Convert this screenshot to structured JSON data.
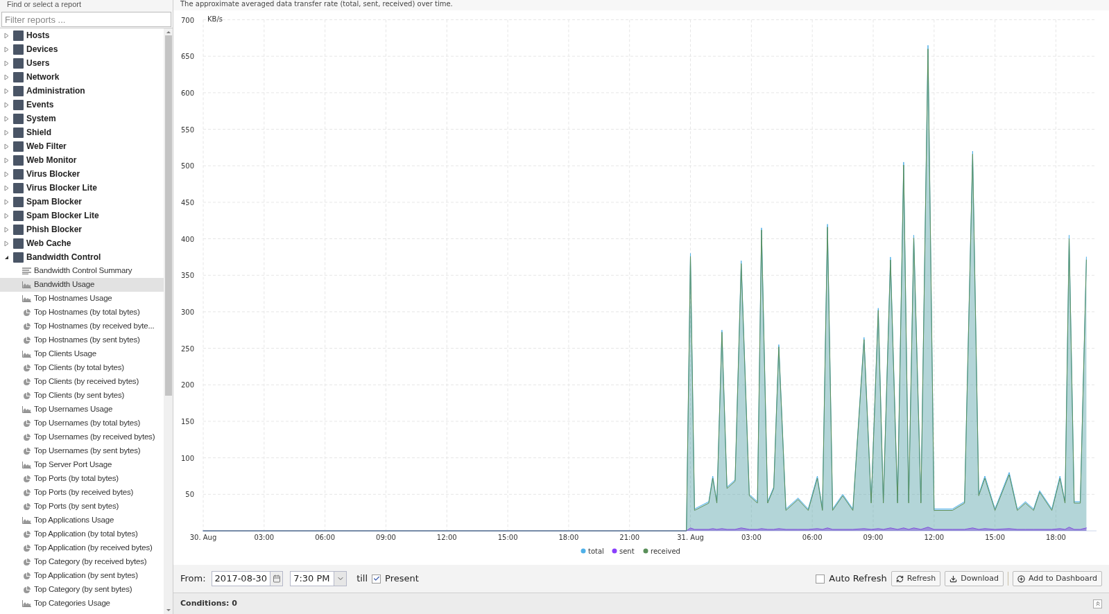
{
  "sidebar": {
    "title": "Find or select a report",
    "filter": {
      "placeholder": "Filter reports ..."
    },
    "items": [
      {
        "label": "Hosts",
        "expanded": false
      },
      {
        "label": "Devices",
        "expanded": false
      },
      {
        "label": "Users",
        "expanded": false
      },
      {
        "label": "Network",
        "expanded": false
      },
      {
        "label": "Administration",
        "expanded": false
      },
      {
        "label": "Events",
        "expanded": false
      },
      {
        "label": "System",
        "expanded": false
      },
      {
        "label": "Shield",
        "expanded": false
      },
      {
        "label": "Web Filter",
        "expanded": false
      },
      {
        "label": "Web Monitor",
        "expanded": false
      },
      {
        "label": "Virus Blocker",
        "expanded": false
      },
      {
        "label": "Virus Blocker Lite",
        "expanded": false
      },
      {
        "label": "Spam Blocker",
        "expanded": false
      },
      {
        "label": "Spam Blocker Lite",
        "expanded": false
      },
      {
        "label": "Phish Blocker",
        "expanded": false
      },
      {
        "label": "Web Cache",
        "expanded": false
      },
      {
        "label": "Bandwidth Control",
        "expanded": true,
        "children": [
          {
            "label": "Bandwidth Control Summary",
            "kind": "text",
            "selected": false
          },
          {
            "label": "Bandwidth Usage",
            "kind": "timeseries",
            "selected": true
          },
          {
            "label": "Top Hostnames Usage",
            "kind": "timeseries",
            "selected": false
          },
          {
            "label": "Top Hostnames (by total bytes)",
            "kind": "pie",
            "selected": false
          },
          {
            "label": "Top Hostnames (by received byte...",
            "kind": "pie",
            "selected": false
          },
          {
            "label": "Top Hostnames (by sent bytes)",
            "kind": "pie",
            "selected": false
          },
          {
            "label": "Top Clients Usage",
            "kind": "timeseries",
            "selected": false
          },
          {
            "label": "Top Clients (by total bytes)",
            "kind": "pie",
            "selected": false
          },
          {
            "label": "Top Clients (by received bytes)",
            "kind": "pie",
            "selected": false
          },
          {
            "label": "Top Clients (by sent bytes)",
            "kind": "pie",
            "selected": false
          },
          {
            "label": "Top Usernames Usage",
            "kind": "timeseries",
            "selected": false
          },
          {
            "label": "Top Usernames (by total bytes)",
            "kind": "pie",
            "selected": false
          },
          {
            "label": "Top Usernames (by received bytes)",
            "kind": "pie",
            "selected": false
          },
          {
            "label": "Top Usernames (by sent bytes)",
            "kind": "pie",
            "selected": false
          },
          {
            "label": "Top Server Port Usage",
            "kind": "timeseries",
            "selected": false
          },
          {
            "label": "Top Ports (by total bytes)",
            "kind": "pie",
            "selected": false
          },
          {
            "label": "Top Ports (by received bytes)",
            "kind": "pie",
            "selected": false
          },
          {
            "label": "Top Ports (by sent bytes)",
            "kind": "pie",
            "selected": false
          },
          {
            "label": "Top Applications Usage",
            "kind": "timeseries",
            "selected": false
          },
          {
            "label": "Top Application (by total bytes)",
            "kind": "pie",
            "selected": false
          },
          {
            "label": "Top Application (by received bytes)",
            "kind": "pie",
            "selected": false
          },
          {
            "label": "Top Category (by received bytes)",
            "kind": "pie",
            "selected": false
          },
          {
            "label": "Top Application (by sent bytes)",
            "kind": "pie",
            "selected": false
          },
          {
            "label": "Top Category (by sent bytes)",
            "kind": "pie",
            "selected": false
          },
          {
            "label": "Top Categories Usage",
            "kind": "timeseries",
            "selected": false
          }
        ]
      }
    ]
  },
  "report": {
    "description": "The approximate averaged data transfer rate (total, sent, received) over time.",
    "chart_data": {
      "type": "area",
      "ylabel": "KB/s",
      "grid": true,
      "legend": "bottom",
      "xlim": [
        "2017-08-30T00:00",
        "2017-08-31T20:00"
      ],
      "ylim": [
        0,
        700
      ],
      "yticks": [
        50,
        100,
        150,
        200,
        250,
        300,
        350,
        400,
        450,
        500,
        550,
        600,
        650,
        700
      ],
      "xticks": [
        {
          "value": "2017-08-30T00:00",
          "label": "30. Aug"
        },
        {
          "value": "2017-08-30T03:00",
          "label": "03:00"
        },
        {
          "value": "2017-08-30T06:00",
          "label": "06:00"
        },
        {
          "value": "2017-08-30T09:00",
          "label": "09:00"
        },
        {
          "value": "2017-08-30T12:00",
          "label": "12:00"
        },
        {
          "value": "2017-08-30T15:00",
          "label": "15:00"
        },
        {
          "value": "2017-08-30T18:00",
          "label": "18:00"
        },
        {
          "value": "2017-08-30T21:00",
          "label": "21:00"
        },
        {
          "value": "2017-08-31T00:00",
          "label": "31. Aug"
        },
        {
          "value": "2017-08-31T03:00",
          "label": "03:00"
        },
        {
          "value": "2017-08-31T06:00",
          "label": "06:00"
        },
        {
          "value": "2017-08-31T09:00",
          "label": "09:00"
        },
        {
          "value": "2017-08-31T12:00",
          "label": "12:00"
        },
        {
          "value": "2017-08-31T15:00",
          "label": "15:00"
        },
        {
          "value": "2017-08-31T18:00",
          "label": "18:00"
        }
      ],
      "x": [
        "2017-08-30T00:00",
        "2017-08-30T23:48",
        "2017-08-31T00:00",
        "2017-08-31T00:12",
        "2017-08-31T00:54",
        "2017-08-31T01:06",
        "2017-08-31T01:18",
        "2017-08-31T01:33",
        "2017-08-31T01:48",
        "2017-08-31T02:12",
        "2017-08-31T02:30",
        "2017-08-31T02:54",
        "2017-08-31T03:18",
        "2017-08-31T03:30",
        "2017-08-31T03:48",
        "2017-08-31T04:06",
        "2017-08-31T04:21",
        "2017-08-31T04:42",
        "2017-08-31T05:18",
        "2017-08-31T05:48",
        "2017-08-31T06:15",
        "2017-08-31T06:30",
        "2017-08-31T06:45",
        "2017-08-31T07:00",
        "2017-08-31T07:30",
        "2017-08-31T08:00",
        "2017-08-31T08:33",
        "2017-08-31T08:54",
        "2017-08-31T09:15",
        "2017-08-31T09:30",
        "2017-08-31T09:51",
        "2017-08-31T10:12",
        "2017-08-31T10:30",
        "2017-08-31T10:45",
        "2017-08-31T11:00",
        "2017-08-31T11:21",
        "2017-08-31T11:42",
        "2017-08-31T12:00",
        "2017-08-31T12:54",
        "2017-08-31T13:30",
        "2017-08-31T13:54",
        "2017-08-31T14:12",
        "2017-08-31T14:30",
        "2017-08-31T15:00",
        "2017-08-31T15:42",
        "2017-08-31T16:06",
        "2017-08-31T16:30",
        "2017-08-31T16:54",
        "2017-08-31T17:12",
        "2017-08-31T17:48",
        "2017-08-31T18:12",
        "2017-08-31T18:27",
        "2017-08-31T18:39",
        "2017-08-31T18:54",
        "2017-08-31T19:12",
        "2017-08-31T19:30"
      ],
      "series": [
        {
          "name": "total",
          "color": "#4fb0e8",
          "values": [
            0,
            0,
            380,
            30,
            40,
            75,
            40,
            275,
            60,
            70,
            370,
            50,
            40,
            415,
            40,
            60,
            255,
            30,
            45,
            30,
            75,
            30,
            420,
            30,
            50,
            30,
            265,
            40,
            305,
            40,
            375,
            40,
            505,
            40,
            405,
            40,
            665,
            30,
            30,
            40,
            520,
            50,
            75,
            30,
            80,
            30,
            40,
            30,
            55,
            30,
            75,
            40,
            405,
            40,
            40,
            375
          ]
        },
        {
          "name": "sent",
          "color": "#8a3ffc",
          "values": [
            0,
            0,
            4,
            2,
            2,
            3,
            2,
            3,
            2,
            2,
            4,
            2,
            2,
            3,
            2,
            2,
            3,
            2,
            2,
            2,
            3,
            2,
            4,
            2,
            2,
            2,
            3,
            2,
            3,
            2,
            4,
            2,
            4,
            2,
            4,
            2,
            5,
            2,
            2,
            2,
            4,
            2,
            3,
            2,
            3,
            2,
            2,
            2,
            2,
            2,
            3,
            2,
            5,
            2,
            2,
            4
          ]
        },
        {
          "name": "received",
          "color": "#5a8f5a",
          "values": [
            0,
            0,
            376,
            28,
            38,
            72,
            38,
            272,
            58,
            68,
            366,
            48,
            38,
            412,
            38,
            58,
            252,
            28,
            43,
            28,
            72,
            28,
            416,
            28,
            48,
            28,
            262,
            38,
            302,
            38,
            371,
            38,
            501,
            38,
            401,
            38,
            660,
            28,
            28,
            38,
            516,
            48,
            72,
            28,
            77,
            28,
            38,
            28,
            53,
            28,
            72,
            38,
            400,
            38,
            38,
            371
          ]
        }
      ]
    }
  },
  "toolbar": {
    "from_label": "From:",
    "date": "2017-08-30",
    "time": "7:30 PM",
    "till_label": "till",
    "present": {
      "label": "Present",
      "checked": true
    },
    "auto_refresh": {
      "label": "Auto Refresh",
      "checked": false
    },
    "buttons": [
      "Refresh",
      "Download",
      "Add to Dashboard"
    ]
  },
  "conditions": {
    "label": "Conditions: 0"
  }
}
